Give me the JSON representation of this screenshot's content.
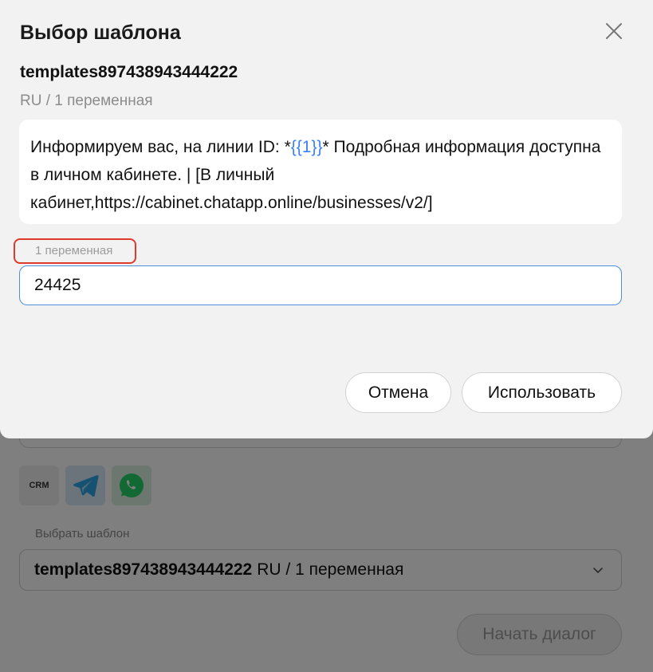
{
  "modal": {
    "title": "Выбор шаблона",
    "template_name": "templates897438943444222",
    "template_meta": "RU / 1 переменная",
    "body_prefix": "Информируем вас, на линии ID: *",
    "body_variable": "{{1}}",
    "body_suffix": "* Подробная информация доступна в личном кабинете. | [В личный кабинет,https://cabinet.chatapp.online/businesses/v2/]",
    "variable_label": "1 переменная",
    "variable_value": "24425",
    "cancel_label": "Отмена",
    "use_label": "Использовать"
  },
  "background": {
    "channels": [
      {
        "name": "crm",
        "label": "CRM"
      },
      {
        "name": "telegram",
        "icon": "telegram-icon"
      },
      {
        "name": "whatsapp",
        "icon": "whatsapp-icon"
      }
    ],
    "select_label": "Выбрать шаблон",
    "selected_template_name": "templates897438943444222",
    "selected_template_meta": "RU / 1 переменная",
    "start_button_label": "Начать диалог"
  },
  "colors": {
    "accent_blue": "#3b82f6",
    "highlight_red": "#e03a2f",
    "telegram": "#2aa3e0",
    "whatsapp": "#25d366"
  }
}
